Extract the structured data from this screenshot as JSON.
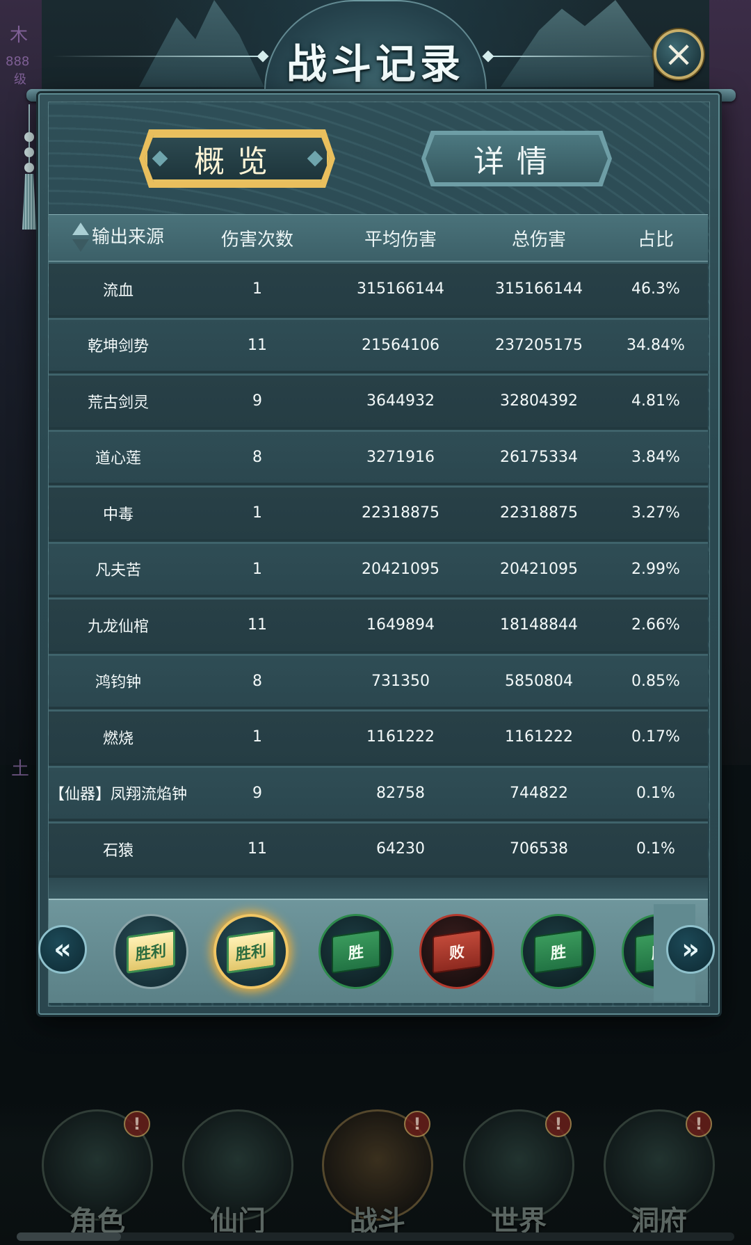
{
  "dialog": {
    "title": "战斗记录",
    "close_icon": "×"
  },
  "tabs": [
    {
      "label": "概览",
      "selected": true
    },
    {
      "label": "详情",
      "selected": false
    }
  ],
  "table": {
    "headers": [
      "输出来源",
      "伤害次数",
      "平均伤害",
      "总伤害",
      "占比"
    ],
    "rows": [
      {
        "source": "流血",
        "hits": "1",
        "avg": "315166144",
        "total": "315166144",
        "pct": "46.3%"
      },
      {
        "source": "乾坤剑势",
        "hits": "11",
        "avg": "21564106",
        "total": "237205175",
        "pct": "34.84%"
      },
      {
        "source": "荒古剑灵",
        "hits": "9",
        "avg": "3644932",
        "total": "32804392",
        "pct": "4.81%"
      },
      {
        "source": "道心莲",
        "hits": "8",
        "avg": "3271916",
        "total": "26175334",
        "pct": "3.84%"
      },
      {
        "source": "中毒",
        "hits": "1",
        "avg": "22318875",
        "total": "22318875",
        "pct": "3.27%"
      },
      {
        "source": "凡夫苦",
        "hits": "1",
        "avg": "20421095",
        "total": "20421095",
        "pct": "2.99%"
      },
      {
        "source": "九龙仙棺",
        "hits": "11",
        "avg": "1649894",
        "total": "18148844",
        "pct": "2.66%"
      },
      {
        "source": "鸿钧钟",
        "hits": "8",
        "avg": "731350",
        "total": "5850804",
        "pct": "0.85%"
      },
      {
        "source": "燃烧",
        "hits": "1",
        "avg": "1161222",
        "total": "1161222",
        "pct": "0.17%"
      },
      {
        "source": "【仙器】凤翔流焰钟",
        "hits": "9",
        "avg": "82758",
        "total": "744822",
        "pct": "0.1%"
      },
      {
        "source": "石猿",
        "hits": "11",
        "avg": "64230",
        "total": "706538",
        "pct": "0.1%"
      }
    ]
  },
  "battle_history": {
    "prev_icon": "«",
    "next_icon": "»",
    "items": [
      {
        "label": "胜利",
        "result": "victory",
        "selected": false
      },
      {
        "label": "胜利",
        "result": "victory",
        "selected": true
      },
      {
        "label": "胜",
        "result": "win",
        "selected": false
      },
      {
        "label": "败",
        "result": "loss",
        "selected": false
      },
      {
        "label": "胜",
        "result": "win",
        "selected": false
      },
      {
        "label": "胜",
        "result": "win",
        "selected": false
      }
    ]
  },
  "bottom_nav": [
    {
      "label": "角色",
      "alert": "!"
    },
    {
      "label": "仙门",
      "alert": ""
    },
    {
      "label": "战斗",
      "alert": "!"
    },
    {
      "label": "世界",
      "alert": "!"
    },
    {
      "label": "洞府",
      "alert": "!"
    }
  ],
  "background": {
    "ghost_texts": [
      "木",
      "888",
      "级",
      "土"
    ]
  },
  "colors": {
    "accent_gold": "#e9bf5d",
    "panel_teal": "#2e4e57",
    "win_green": "#2e8a4c",
    "loss_red": "#b33a2e"
  }
}
